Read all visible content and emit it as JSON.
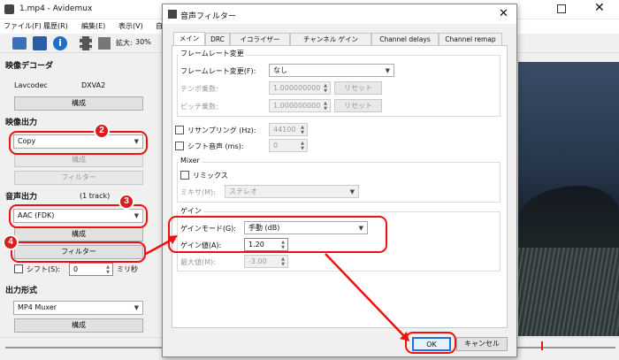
{
  "main_window": {
    "title": "1.mp4 - Avidemux",
    "menu": [
      "ファイル(F)",
      "履歴(R)",
      "編集(E)",
      "表示(V)",
      "自動"
    ],
    "zoom_label": "拡大:",
    "zoom_value": "30%"
  },
  "left_panel": {
    "video_decoder": {
      "heading": "映像デコーダ",
      "codec_label": "Lavcodec",
      "codec_value": "DXVA2",
      "config_label": "構成"
    },
    "video_output": {
      "heading": "映像出力",
      "selected": "Copy",
      "config_label": "構成",
      "filter_label": "フィルター"
    },
    "audio_output": {
      "heading": "音声出力",
      "tracks": "(1 track)",
      "selected": "AAC (FDK)",
      "config_label": "構成",
      "filter_label": "フィルター",
      "shift_label": "シフト(S):",
      "shift_value": "0",
      "shift_unit": "ミリ秒"
    },
    "output_format": {
      "heading": "出力形式",
      "selected": "MP4 Muxer",
      "config_label": "構成"
    }
  },
  "dialog": {
    "title": "音声フィルター",
    "tabs": [
      "メイン",
      "DRC",
      "イコライザー",
      "チャンネル ゲイン",
      "Channel delays",
      "Channel remap"
    ],
    "framerate": {
      "group": "フレームレート変更",
      "label": "フレームレート変更(F):",
      "value": "なし",
      "tempo_label": "テンポ乗数:",
      "tempo_value": "1.000000000",
      "pitch_label": "ピッチ乗数:",
      "pitch_value": "1.000000000",
      "reset_label": "リセット"
    },
    "resampling_label": "リサンプリング (Hz):",
    "resampling_value": "44100",
    "shift_label": "シフト音声 (ms):",
    "shift_value": "0",
    "mixer": {
      "group": "Mixer",
      "remix_label": "リミックス",
      "mixer_label": "ミキサ(M):",
      "mixer_value": "ステレオ"
    },
    "gain": {
      "group": "ゲイン",
      "mode_label": "ゲインモード(G):",
      "mode_value": "手動 (dB)",
      "value_label": "ゲイン値(A):",
      "value": "1.20",
      "max_label": "最大値(M):",
      "max_value": "-3.00"
    },
    "ok_label": "OK",
    "cancel_label": "キャンセル"
  },
  "annotations": [
    "2",
    "3",
    "4"
  ],
  "colors": {
    "annotation": "#e11111",
    "dialog_bg": "#f0f0f0",
    "preview_sky": "#1c2a3e"
  }
}
